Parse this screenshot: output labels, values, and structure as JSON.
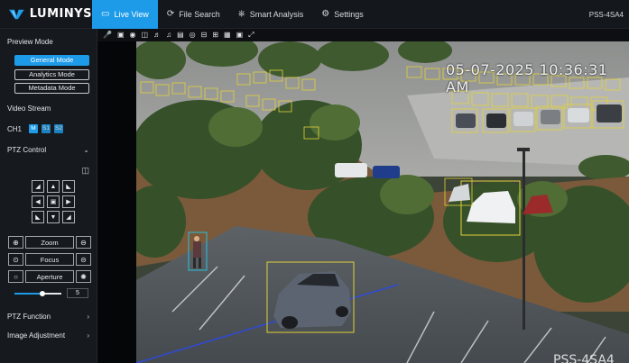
{
  "brand": {
    "name": "LUMINYS"
  },
  "nav": {
    "tabs": [
      {
        "label": "Live View",
        "icon": "monitor-icon",
        "active": true
      },
      {
        "label": "File Search",
        "icon": "history-icon",
        "active": false
      },
      {
        "label": "Smart Analysis",
        "icon": "analysis-icon",
        "active": false
      },
      {
        "label": "Settings",
        "icon": "gear-icon",
        "active": false
      }
    ],
    "model": "PSS-4SA4"
  },
  "preview_mode": {
    "title": "Preview Mode",
    "buttons": [
      {
        "label": "General Mode",
        "active": true
      },
      {
        "label": "Analytics Mode",
        "active": false
      },
      {
        "label": "Metadata Mode",
        "active": false
      }
    ]
  },
  "video_stream": {
    "title": "Video Stream",
    "channel": "CH1",
    "streams": [
      "M",
      "S1",
      "S2"
    ]
  },
  "ptz_control": {
    "title": "PTZ Control",
    "controls": {
      "zoom": "Zoom",
      "focus": "Focus",
      "aperture": "Aperture"
    },
    "speed": "5",
    "speed_level": 0.6
  },
  "ptz_function": {
    "title": "PTZ Function"
  },
  "image_adjustment": {
    "title": "Image Adjustment"
  },
  "video": {
    "timestamp": "05-07-2025 10:36:31 AM",
    "watermark": "PSS-4SA4"
  },
  "colors": {
    "accent": "#1e9be8",
    "box_vehicle": "#e2d13a",
    "box_person": "#29c0e0",
    "tripwire": "#2e4ad8"
  }
}
